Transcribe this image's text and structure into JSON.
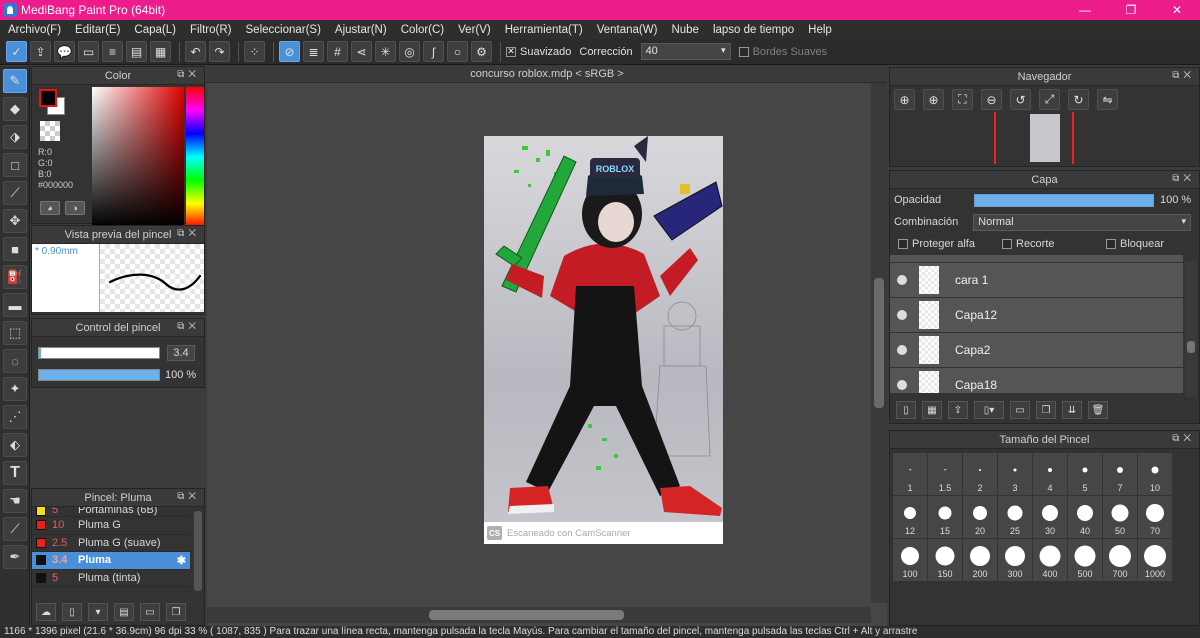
{
  "window": {
    "title": "MediBang Paint Pro (64bit)",
    "min": "—",
    "max": "❐",
    "close": "✕"
  },
  "menu": [
    "Archivo(F)",
    "Editar(E)",
    "Capa(L)",
    "Filtro(R)",
    "Seleccionar(S)",
    "Ajustar(N)",
    "Color(C)",
    "Ver(V)",
    "Herramienta(T)",
    "Ventana(W)",
    "Nube",
    "lapso de tiempo",
    "Help"
  ],
  "toolbar": {
    "smoothing_label": "Suavizado",
    "correction_label": "Corrección",
    "correction_value": "40",
    "soft_edges_label": "Bordes Suaves"
  },
  "color_panel": {
    "title": "Color",
    "r": "R:0",
    "g": "G:0",
    "b": "B:0",
    "hex": "#000000",
    "fg_color": "#000000",
    "bg_color": "#ffffff"
  },
  "brush_preview": {
    "title": "Vista previa del pincel",
    "size": "0.90mm"
  },
  "brush_control": {
    "title": "Control del pincel",
    "size_value": "3.4",
    "size_fraction": 0.02,
    "opacity_value": "100 %",
    "opacity_fraction": 1.0
  },
  "brush_list": {
    "title": "Pincel: Pluma",
    "items": [
      {
        "size": "5",
        "name": "Portaminas (6B)",
        "color": "#f0e020"
      },
      {
        "size": "10",
        "name": "Pluma G",
        "color": "#e82020"
      },
      {
        "size": "2.5",
        "name": "Pluma G (suave)",
        "color": "#e82020"
      },
      {
        "size": "3.4",
        "name": "Pluma",
        "color": "#111111"
      },
      {
        "size": "5",
        "name": "Pluma (tinta)",
        "color": "#111111"
      }
    ]
  },
  "canvas": {
    "doc_title": "concurso roblox.mdp < sRGB >",
    "footer_badge": "CS",
    "footer_text": "Escaneado con CamScanner",
    "hat_text": "ROBLOX"
  },
  "navigator": {
    "title": "Navegador"
  },
  "layers": {
    "title": "Capa",
    "opacity_label": "Opacidad",
    "opacity_value": "100 %",
    "opacity_fraction": 1.0,
    "blend_label": "Combinación",
    "blend_value": "Normal",
    "protect_alpha": "Proteger alfa",
    "clip": "Recorte",
    "lock": "Bloquear",
    "items": [
      "cara 1",
      "Capa12",
      "Capa2",
      "Capa18"
    ]
  },
  "brush_size": {
    "title": "Tamaño del Pincel",
    "sizes": [
      "1",
      "1.5",
      "2",
      "3",
      "4",
      "5",
      "7",
      "10",
      "12",
      "15",
      "20",
      "25",
      "30",
      "40",
      "50",
      "70",
      "100",
      "150",
      "200",
      "300",
      "400",
      "500",
      "700",
      "1000"
    ]
  },
  "status": "1166 * 1396 pixel   (21.6 * 36.9cm)   96 dpi   33 %   ( 1087, 835 )   Para trazar una línea recta, mantenga pulsada la tecla Mayús. Para cambiar el tamaño del pincel, mantenga pulsada las teclas Ctrl + Alt y arrastre"
}
